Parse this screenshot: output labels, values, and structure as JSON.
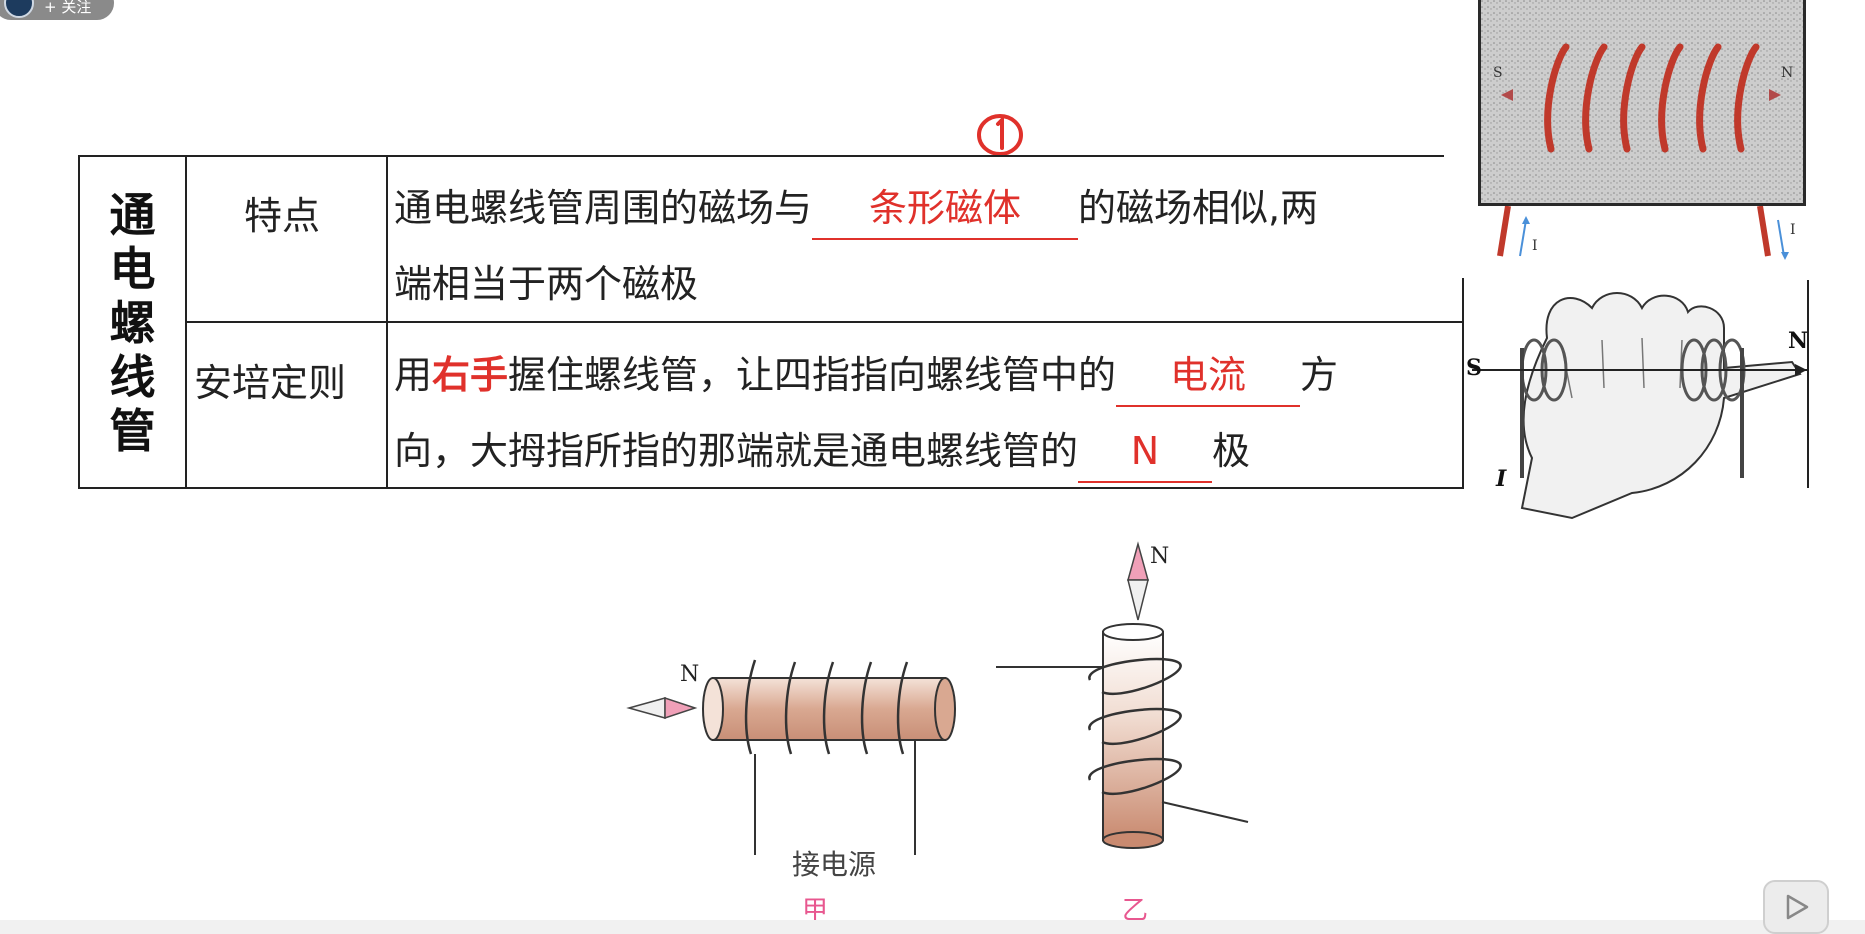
{
  "follow": {
    "label": "+ 关注"
  },
  "annotation": {
    "mark": "①"
  },
  "table": {
    "title_chars": [
      "通",
      "电",
      "螺",
      "线",
      "管"
    ],
    "row1": {
      "label": "特点",
      "line1_pre": "通电螺线管周围的磁场与",
      "blank1": "条形磁体",
      "line1_post": "的磁场相似,两",
      "line2": "端相当于两个磁极"
    },
    "row2": {
      "label": "安培定则",
      "pre": "用",
      "emph": "右手",
      "line1_mid": "握住螺线管，让四指指向螺线管中的",
      "blank_current": "电流",
      "line1_post": "方",
      "line2_pre": "向，大拇指所指的那端就是通电螺线管的",
      "blank_pole": "N",
      "line2_post": "极"
    }
  },
  "photo": {
    "left": "S",
    "right": "N",
    "current_left": "I",
    "current_right": "I"
  },
  "hand": {
    "s": "S",
    "n": "N",
    "i": "I"
  },
  "figures": {
    "jia": {
      "n": "N",
      "power": "接电源",
      "caption": "甲"
    },
    "yi": {
      "n": "N",
      "caption": "乙"
    }
  },
  "colors": {
    "red": "#e0312b",
    "pink": "#e8578f",
    "coil": "#d9a891"
  }
}
